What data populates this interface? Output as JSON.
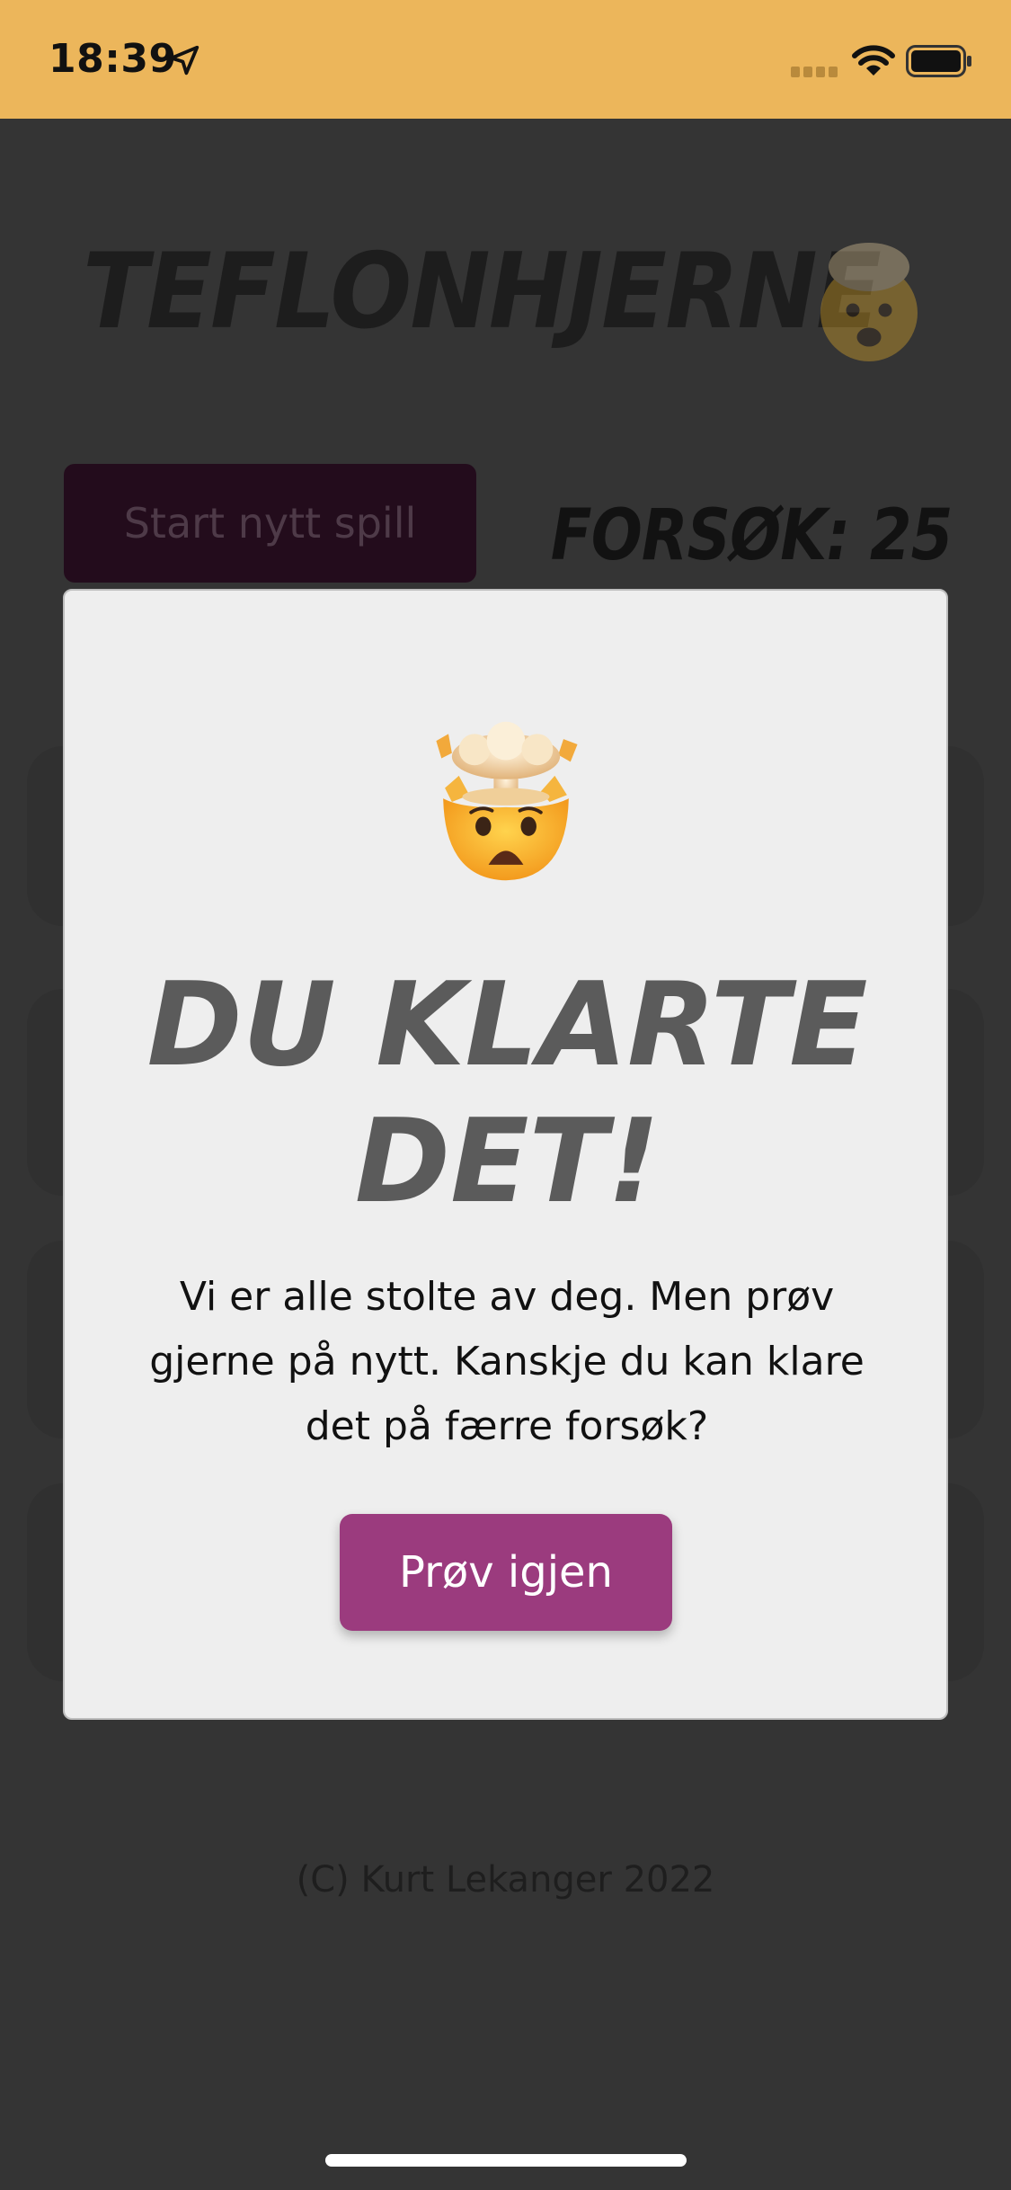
{
  "status_bar": {
    "time": "18:39",
    "background": "#ecb65b",
    "icons": [
      "location-icon",
      "signal-icon",
      "wifi-icon",
      "battery-icon"
    ]
  },
  "app": {
    "title": "TEFLONHJERNE",
    "title_emoji": "exploding-head-icon",
    "start_button_label": "Start nytt spill",
    "attempts_label": "FORSØK: 25",
    "footer": "(C) Kurt Lekanger 2022",
    "accent_color": "#9b3b7e"
  },
  "modal": {
    "emoji": "exploding-head-icon",
    "title_line1": "DU KLARTE",
    "title_line2": "DET!",
    "message": "Vi er alle stolte av deg. Men prøv gjerne på nytt. Kanskje du kan klare det på færre forsøk?",
    "retry_button_label": "Prøv igjen"
  }
}
